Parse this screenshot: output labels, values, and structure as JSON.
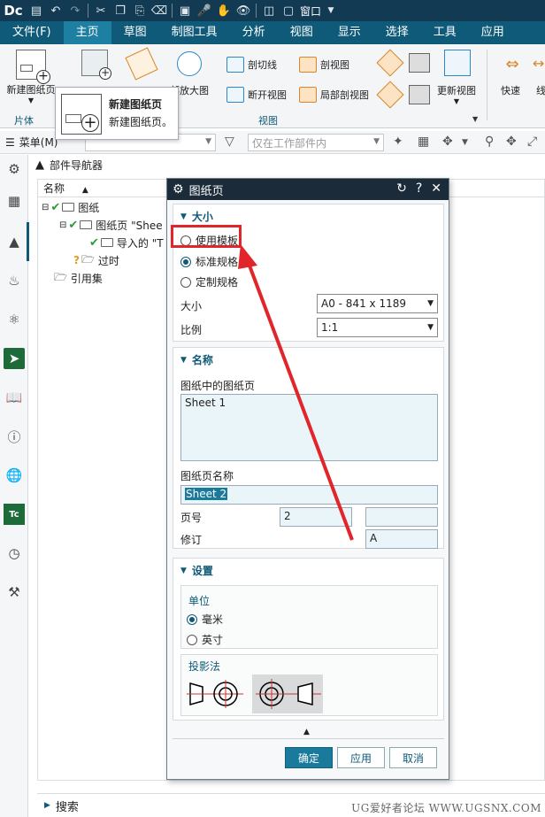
{
  "titlebar": {
    "logo": "Dc",
    "window_label": "窗口"
  },
  "menu": [
    "文件(F)",
    "主页",
    "草图",
    "制图工具",
    "分析",
    "视图",
    "显示",
    "选择",
    "工具",
    "应用"
  ],
  "ribbon": {
    "new_sheet_label": "新建图纸页",
    "group_left": "片体",
    "group_view": "视图",
    "zoom_view": "部放大图",
    "section_line": "剖切线",
    "section_view": "剖视图",
    "break_view": "断开视图",
    "local_section": "局部剖视图",
    "update_view": "更新视图",
    "quick": "快速",
    "line_cut": "线"
  },
  "tooltip": {
    "title": "新建图纸页",
    "desc": "新建图纸页。"
  },
  "filterbar": {
    "menu": "菜单(M)",
    "select_placeholder": "仅在工作部件内"
  },
  "navigator": {
    "title": "部件导航器",
    "column": "名称",
    "rows": [
      "图纸",
      "图纸页 \"Shee",
      "导入的 \"T",
      "过时",
      "引用集"
    ]
  },
  "search": "搜索",
  "watermark": "UG爱好者论坛 WWW.UGSNX.COM",
  "dialog": {
    "title": "图纸页",
    "size_section": "大小",
    "use_template": "使用模板",
    "standard_size": "标准规格",
    "custom_size": "定制规格",
    "size_label": "大小",
    "size_value": "A0 - 841 x 1189",
    "scale_label": "比例",
    "scale_value": "1:1",
    "name_section": "名称",
    "sheets_in_drawing": "图纸中的图纸页",
    "sheet_list": "Sheet 1",
    "sheet_name_label": "图纸页名称",
    "sheet_name_value": "Sheet 2",
    "page_label": "页号",
    "page_value": "2",
    "revision_label": "修订",
    "revision_value": "A",
    "settings_section": "设置",
    "unit_label": "单位",
    "mm": "毫米",
    "inch": "英寸",
    "projection_label": "投影法",
    "ok": "确定",
    "apply": "应用",
    "cancel": "取消"
  },
  "colors": {
    "menubar": "#0f5a78",
    "titlebar": "#123a52",
    "accent": "#1a7a9c",
    "highlight": "#e0262b"
  }
}
